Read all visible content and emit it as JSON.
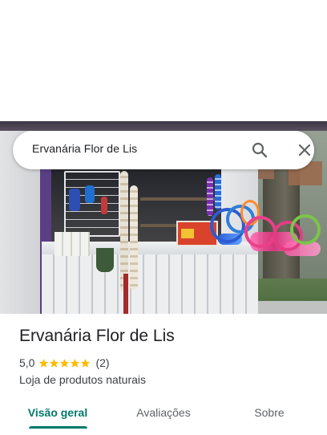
{
  "search": {
    "query": "Ervanária Flor de Lis",
    "search_icon": "search-icon",
    "close_icon": "close-icon"
  },
  "place": {
    "name": "Ervanária Flor de Lis",
    "rating": "5,0",
    "rating_stars": 5,
    "reviews_count": "(2)",
    "category": "Loja de produtos naturais"
  },
  "tabs": [
    {
      "label": "Visão geral",
      "selected": true
    },
    {
      "label": "Avaliações",
      "selected": false
    },
    {
      "label": "Sobre",
      "selected": false
    }
  ],
  "colors": {
    "accent": "#00796b",
    "star": "#fbbc04",
    "text_primary": "#202124",
    "text_secondary": "#3c4043",
    "tab_inactive": "#5f6368"
  }
}
